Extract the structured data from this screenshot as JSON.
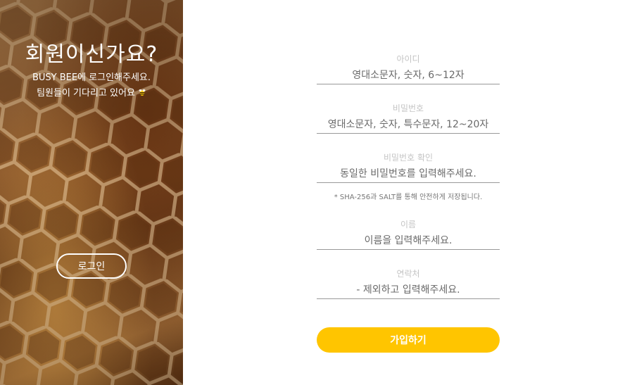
{
  "welcome": {
    "title": "회원이신가요?",
    "line1": "BUSY BEE에 로그인해주세요.",
    "line2": "팀원들이 기다리고 있어요",
    "login_label": "로그인"
  },
  "form": {
    "fields": [
      {
        "label": "아이디",
        "placeholder": "영대소문자, 숫자, 6~12자",
        "type": "text"
      },
      {
        "label": "비밀번호",
        "placeholder": "영대소문자, 숫자, 특수문자, 12~20자",
        "type": "password"
      },
      {
        "label": "비밀번호 확인",
        "placeholder": "동일한 비밀번호를 입력해주세요.",
        "type": "password"
      },
      {
        "label": "이름",
        "placeholder": "이름을 입력해주세요.",
        "type": "text"
      },
      {
        "label": "연락처",
        "placeholder": "- 제외하고 입력해주세요.",
        "type": "text"
      }
    ],
    "hint": "* SHA-256과 SALT를 통해 안전하게 저장됩니다.",
    "signup_label": "가입하기"
  },
  "colors": {
    "accent": "#ffc500",
    "label": "#c4c4c4",
    "underline": "#999999"
  },
  "icons": {
    "welcome_emoji": "bee-icon"
  }
}
